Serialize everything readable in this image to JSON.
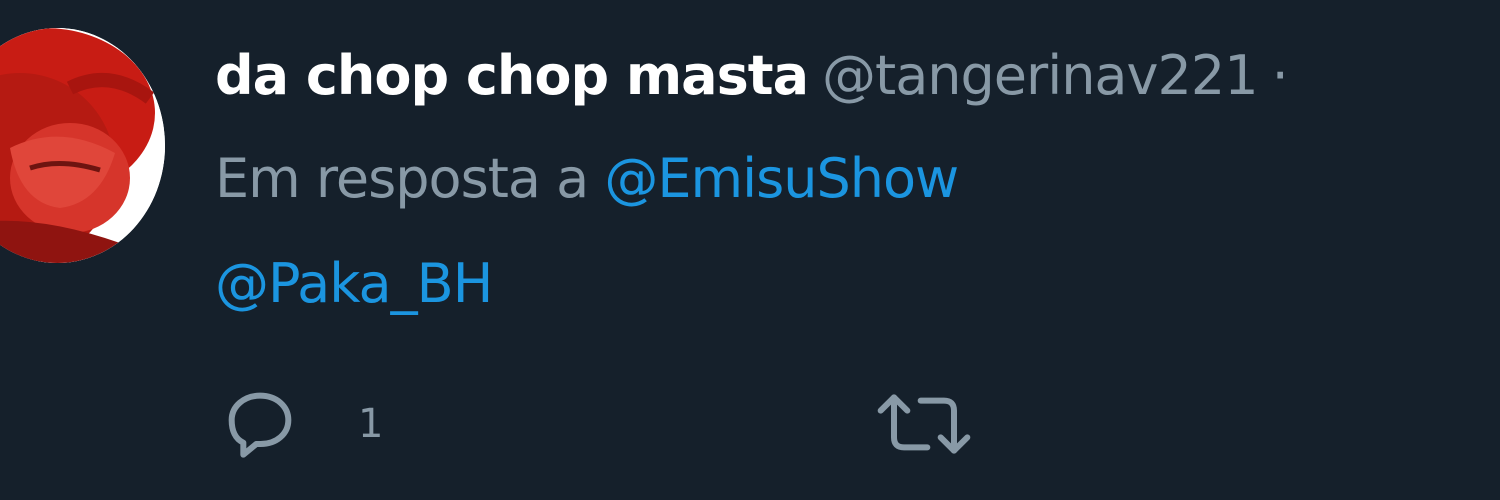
{
  "tweet": {
    "display_name": "da chop chop masta",
    "handle": "@tangerinav221",
    "separator": "·",
    "reply_prefix": "Em resposta a",
    "mentions": [
      "@EmisuShow",
      "@Paka_BH"
    ],
    "actions": {
      "reply": {
        "icon": "reply-icon",
        "count": "1"
      },
      "retweet": {
        "icon": "retweet-icon"
      }
    }
  },
  "colors": {
    "background": "#15202b",
    "primary_text": "#ffffff",
    "secondary_text": "#8899a6",
    "link": "#1b95e0"
  }
}
